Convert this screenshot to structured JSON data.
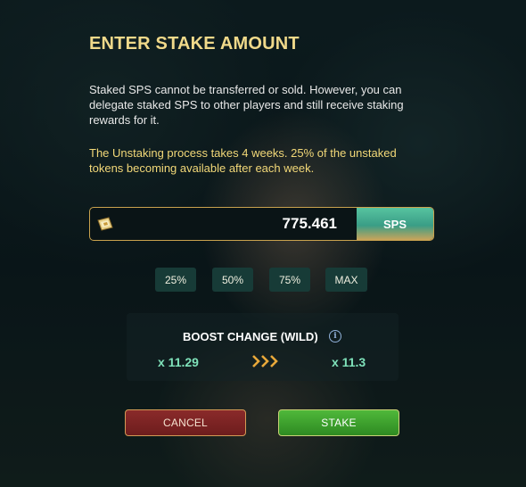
{
  "modal": {
    "title": "ENTER STAKE AMOUNT",
    "description": "Staked SPS cannot be transferred or sold. However, you can delegate staked SPS to other players and still receive staking rewards for it.",
    "warning": "The Unstaking process takes 4 weeks. 25% of the unstaked tokens becoming available after each week."
  },
  "amount": {
    "value": "775.461",
    "currency": "SPS",
    "token_icon": "sps-token-icon"
  },
  "percent_buttons": [
    {
      "label": "25%"
    },
    {
      "label": "50%"
    },
    {
      "label": "75%"
    },
    {
      "label": "MAX"
    }
  ],
  "boost": {
    "title": "BOOST CHANGE (WILD)",
    "info_icon": "info-icon",
    "from": "x 11.29",
    "to": "x 11.3",
    "arrow_icon": "triple-chevron-right-icon"
  },
  "actions": {
    "cancel_label": "CANCEL",
    "stake_label": "STAKE"
  },
  "colors": {
    "title": "#f0d98a",
    "warning": "#f2d878",
    "boost_value": "#7fe2ba",
    "accent_border": "#c9a24e",
    "cancel_bg": "#7a2424",
    "stake_bg": "#3fa22e"
  }
}
